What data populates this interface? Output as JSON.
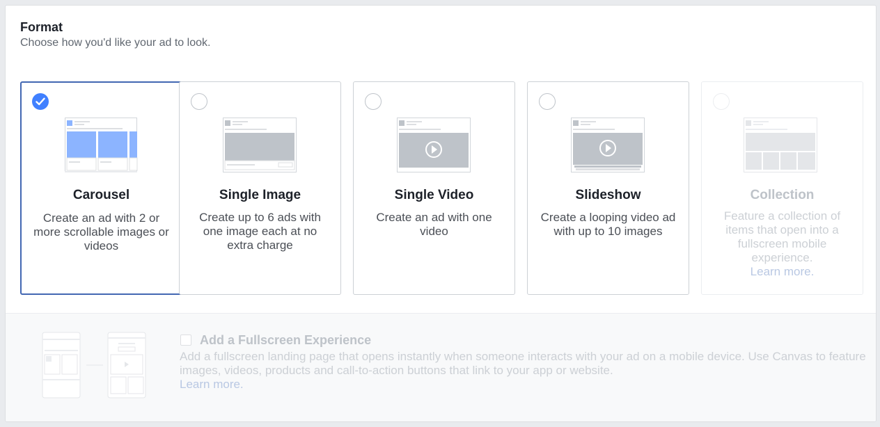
{
  "format": {
    "title": "Format",
    "subtitle": "Choose how you'd like your ad to look."
  },
  "cards": [
    {
      "title": "Carousel",
      "description": "Create an ad with 2 or more scrollable images or videos",
      "selected": true,
      "disabled": false
    },
    {
      "title": "Single Image",
      "description": "Create up to 6 ads with one image each at no extra charge",
      "selected": false,
      "disabled": false
    },
    {
      "title": "Single Video",
      "description": "Create an ad with one video",
      "selected": false,
      "disabled": false
    },
    {
      "title": "Slideshow",
      "description": "Create a looping video ad with up to 10 images",
      "selected": false,
      "disabled": false
    },
    {
      "title": "Collection",
      "description": "Feature a collection of items that open into a fullscreen mobile experience.",
      "link": "Learn more.",
      "selected": false,
      "disabled": true
    }
  ],
  "fullscreen": {
    "title": "Add a Fullscreen Experience",
    "description": "Add a fullscreen landing page that opens instantly when someone interacts with your ad on a mobile device. Use Canvas to feature images, videos, products and call-to-action buttons that link to your app or website.",
    "link": "Learn more.",
    "checked": false
  },
  "colors": {
    "accent": "#4080ff",
    "selected_border": "#4267b2",
    "thumb_blue": "#8cb4ff",
    "thumb_gray": "#bec3c9"
  },
  "icons": {
    "selected": "check-icon",
    "video": "play-icon"
  }
}
